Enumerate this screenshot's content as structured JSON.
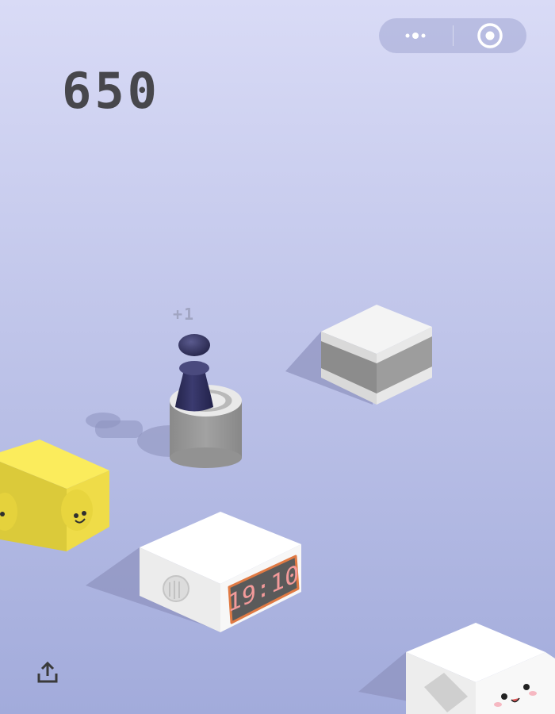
{
  "game": {
    "score": "650",
    "bonus": "+1",
    "clock_time": "19:10",
    "colors": {
      "background_top": "#d9dbf6",
      "background_bottom": "#a2abdb",
      "score_text": "#47474c",
      "player": "#2f2f5e",
      "yellow_cube": "#f6e04a"
    }
  },
  "capsule": {
    "more_icon": "more-dots-icon",
    "close_icon": "target-circle-icon"
  },
  "toolbar": {
    "share_icon": "share-upload-icon"
  }
}
